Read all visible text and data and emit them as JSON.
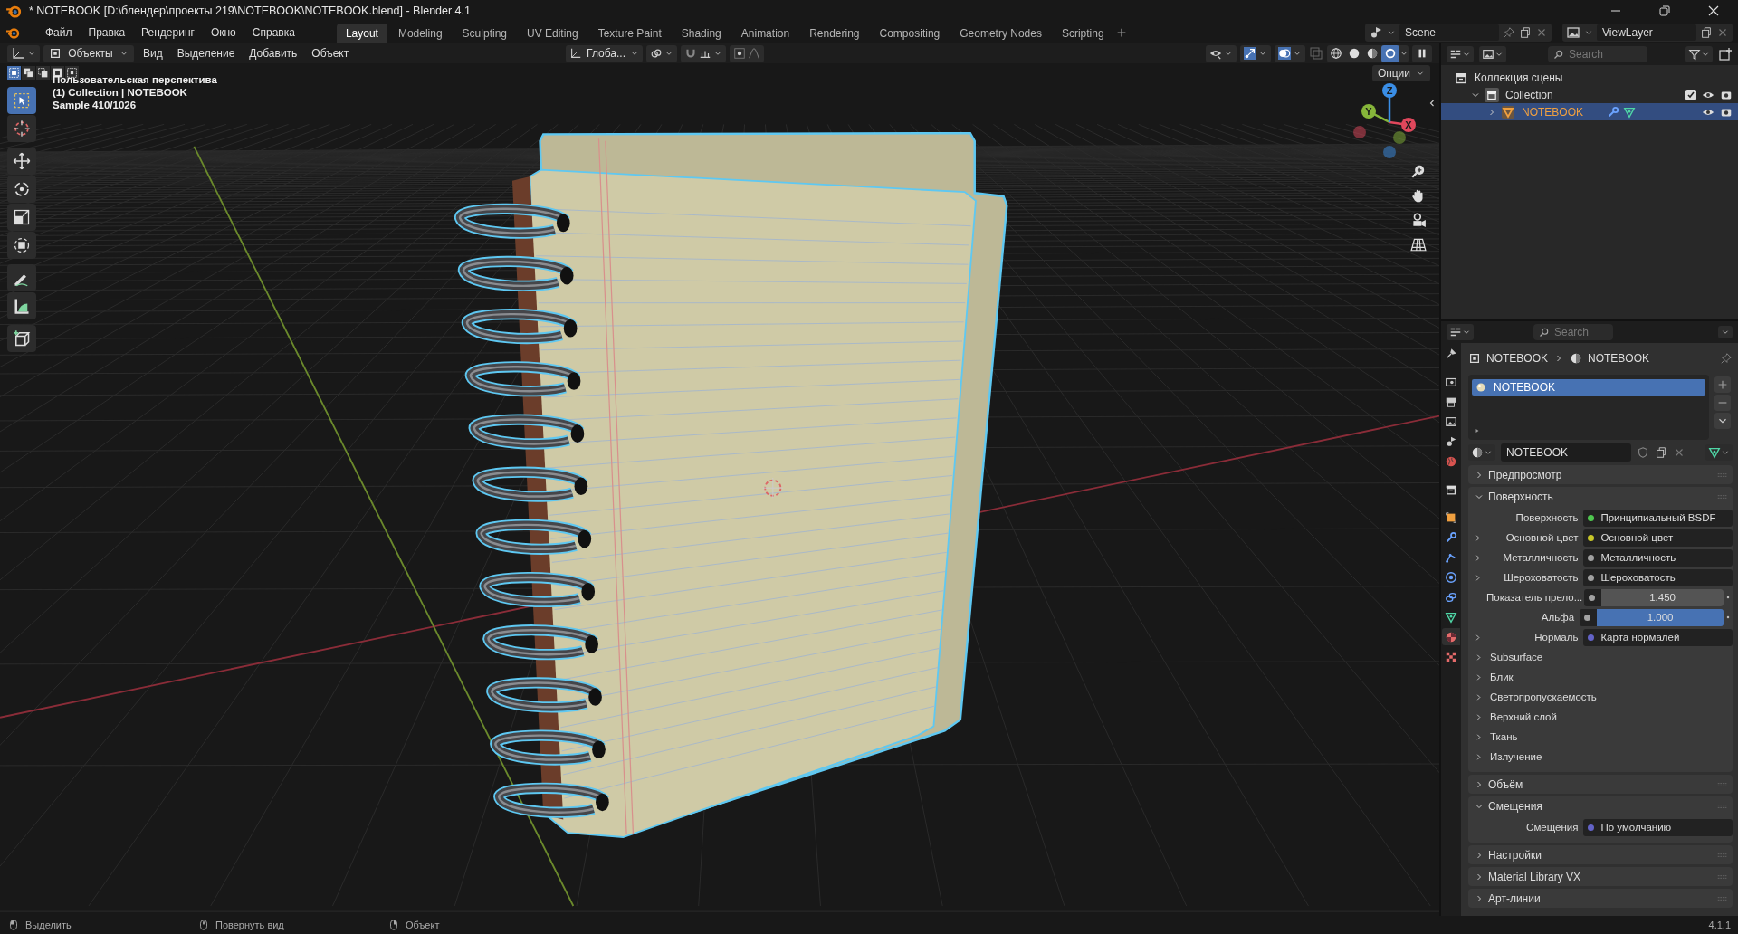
{
  "window": {
    "title": "* NOTEBOOK [D:\\блендер\\проекты 219\\NOTEBOOK\\NOTEBOOK.blend] - Blender 4.1"
  },
  "menu": [
    "Файл",
    "Правка",
    "Рендеринг",
    "Окно",
    "Справка"
  ],
  "workspaces": [
    {
      "label": "Layout",
      "selected": true
    },
    {
      "label": "Modeling",
      "selected": false
    },
    {
      "label": "Sculpting",
      "selected": false
    },
    {
      "label": "UV Editing",
      "selected": false
    },
    {
      "label": "Texture Paint",
      "selected": false
    },
    {
      "label": "Shading",
      "selected": false
    },
    {
      "label": "Animation",
      "selected": false
    },
    {
      "label": "Rendering",
      "selected": false
    },
    {
      "label": "Compositing",
      "selected": false
    },
    {
      "label": "Geometry Nodes",
      "selected": false
    },
    {
      "label": "Scripting",
      "selected": false
    }
  ],
  "scene": {
    "name": "Scene"
  },
  "view_layer": {
    "name": "ViewLayer"
  },
  "viewport": {
    "mode": "Объекты",
    "menus": [
      "Вид",
      "Выделение",
      "Добавить",
      "Объект"
    ],
    "orientation": "Глоба...",
    "options": "Опции",
    "shading": [
      {
        "kind": "wireframe",
        "selected": false
      },
      {
        "kind": "solid",
        "selected": false
      },
      {
        "kind": "material",
        "selected": false
      },
      {
        "kind": "rendered",
        "selected": true
      }
    ],
    "overlay": [
      "Пользовательская перспектива",
      "(1) Collection | NOTEBOOK",
      "Sample 410/1026"
    ],
    "tools": [
      {
        "kind": "select",
        "selected": true
      },
      {
        "kind": "cursor",
        "selected": false
      },
      {
        "kind": "move",
        "selected": false
      },
      {
        "kind": "rotate",
        "selected": false
      },
      {
        "kind": "scale",
        "selected": false
      },
      {
        "kind": "transform",
        "selected": false
      },
      {
        "kind": "annotate",
        "selected": false
      },
      {
        "kind": "measure",
        "selected": false
      },
      {
        "kind": "add-cube",
        "selected": false
      }
    ],
    "gizmo": [
      {
        "label": "X",
        "color": "#e0475c"
      },
      {
        "label": "Y",
        "color": "#86b53a"
      },
      {
        "label": "Z",
        "color": "#3a8ee6"
      }
    ]
  },
  "outliner": {
    "search": {
      "placeholder": "Search"
    },
    "tree": [
      {
        "label": "Коллекция сцены",
        "kind": "scene",
        "selected": false,
        "children": [
          {
            "label": "Collection",
            "kind": "collection",
            "selected": false,
            "expanded": true,
            "checked": true,
            "children": [
              {
                "label": "NOTEBOOK",
                "kind": "object",
                "selected": true,
                "expanded": false
              }
            ]
          }
        ]
      }
    ]
  },
  "properties": {
    "search": {
      "placeholder": "Search"
    },
    "tabs": [
      {
        "kind": "tool",
        "selected": false
      },
      {
        "kind": "render",
        "selected": false
      },
      {
        "kind": "output",
        "selected": false
      },
      {
        "kind": "view_layer",
        "selected": false
      },
      {
        "kind": "scene",
        "selected": false
      },
      {
        "kind": "world",
        "selected": false
      },
      {
        "kind": "collection",
        "selected": false
      },
      {
        "kind": "object",
        "selected": false
      },
      {
        "kind": "modifier",
        "selected": false
      },
      {
        "kind": "particles",
        "selected": false
      },
      {
        "kind": "physics",
        "selected": false
      },
      {
        "kind": "constraints",
        "selected": false
      },
      {
        "kind": "data",
        "selected": false
      },
      {
        "kind": "material",
        "selected": true
      },
      {
        "kind": "texture",
        "selected": false
      }
    ],
    "breadcrumb": [
      "NOTEBOOK",
      "NOTEBOOK"
    ],
    "slots": [
      {
        "name": "NOTEBOOK",
        "selected": true
      }
    ],
    "material": "NOTEBOOK",
    "panels": [
      {
        "title": "Предпросмотр",
        "expanded": false
      },
      {
        "title": "Поверхность",
        "expanded": true,
        "rows": [
          {
            "kind": "socket",
            "label": "Поверхность",
            "value": "Принципиальный BSDF",
            "color": "#4fc64f",
            "expandable": false
          },
          {
            "kind": "socket",
            "label": "Основной цвет",
            "value": "Основной цвет",
            "color": "#c7c729",
            "expandable": true
          },
          {
            "kind": "socket",
            "label": "Металличность",
            "value": "Металличность",
            "color": "#a1a1a1",
            "expandable": true
          },
          {
            "kind": "socket",
            "label": "Шероховатость",
            "value": "Шероховатость",
            "color": "#a1a1a1",
            "expandable": true
          },
          {
            "kind": "number",
            "label": "Показатель прело...",
            "value": "1.450",
            "color": "#a1a1a1"
          },
          {
            "kind": "slider",
            "label": "Альфа",
            "value": "1.000",
            "level": 1,
            "color": "#a1a1a1"
          },
          {
            "kind": "socket",
            "label": "Нормаль",
            "value": "Карта нормалей",
            "color": "#6363c7",
            "expandable": true
          },
          {
            "kind": "group",
            "label": "Subsurface"
          },
          {
            "kind": "group",
            "label": "Блик"
          },
          {
            "kind": "group",
            "label": "Светопропускаемость"
          },
          {
            "kind": "group",
            "label": "Верхний слой"
          },
          {
            "kind": "group",
            "label": "Ткань"
          },
          {
            "kind": "group",
            "label": "Излучение"
          }
        ]
      },
      {
        "title": "Объём",
        "expanded": false
      },
      {
        "title": "Смещения",
        "expanded": true,
        "rows": [
          {
            "kind": "socket",
            "label": "Смещения",
            "value": "По умолчанию",
            "color": "#6363c7",
            "expandable": false
          }
        ]
      },
      {
        "title": "Настройки",
        "expanded": false
      },
      {
        "title": "Material Library VX",
        "expanded": false
      },
      {
        "title": "Арт-линии",
        "expanded": false
      }
    ]
  },
  "status_bar": {
    "hints": [
      "Выделить",
      "Повернуть вид",
      "Объект"
    ],
    "version": "4.1.1"
  }
}
